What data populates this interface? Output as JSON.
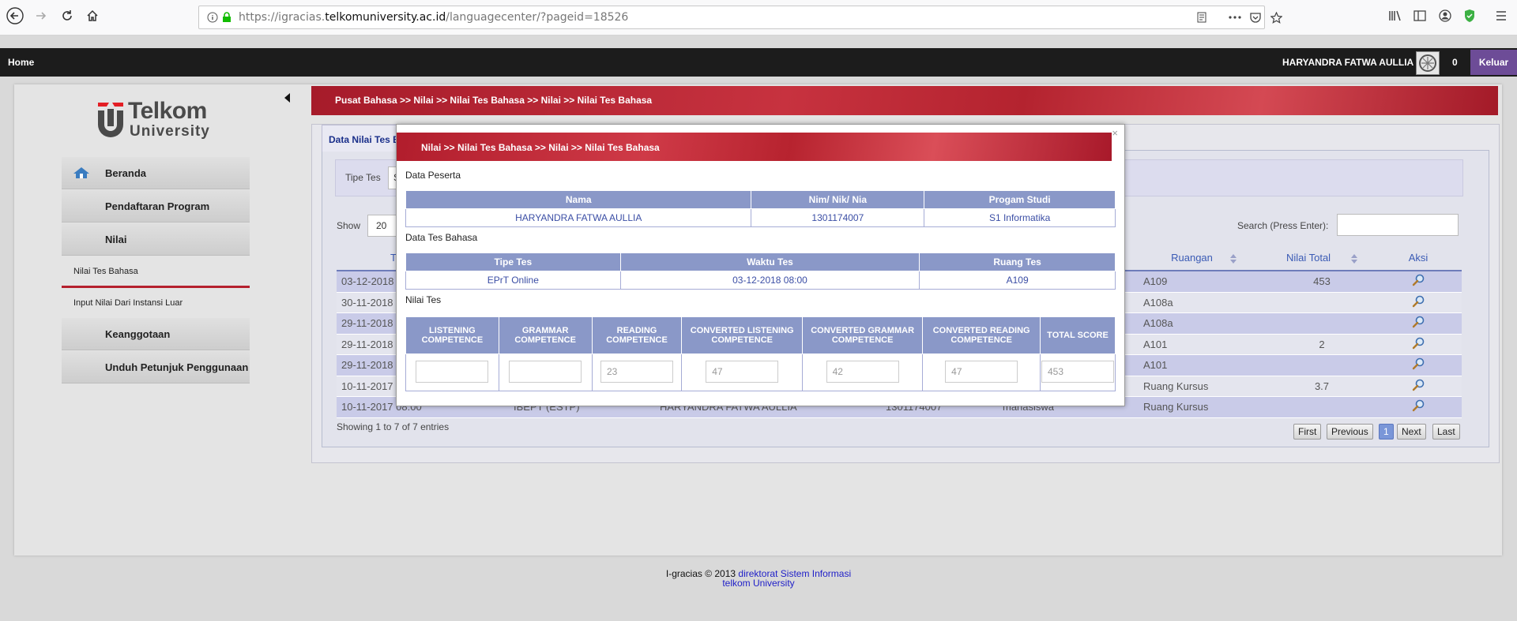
{
  "browser": {
    "url_prefix": "https://igracias.",
    "url_domain": "telkomuniversity.ac.id",
    "url_path": "/languagecenter/?pageid=18526"
  },
  "topnav": {
    "home": "Home",
    "user_name": "HARYANDRA FATWA AULLIA",
    "notif_count": "0",
    "logout": "Keluar"
  },
  "logo": {
    "word": "Telkom",
    "sub": "University"
  },
  "sidebar": {
    "items": [
      {
        "label": "Beranda"
      },
      {
        "label": "Pendaftaran Program"
      },
      {
        "label": "Nilai"
      }
    ],
    "sub_active": "Nilai Tes Bahasa",
    "sub_other": "Input Nilai Dari Instansi Luar",
    "items2": [
      {
        "label": "Keanggotaan"
      },
      {
        "label": "Unduh Petunjuk Penggunaan"
      }
    ]
  },
  "breadcrumb": "Pusat Bahasa >> Nilai >> Nilai Tes Bahasa >> Nilai >> Nilai Tes Bahasa",
  "panel": {
    "tab": "Data Nilai Tes B",
    "filter_label": "Tipe Tes",
    "filter_value": "S",
    "show_label": "Show",
    "show_value": "20",
    "search_label": "Search (Press Enter):",
    "showing": "Showing 1 to 7 of 7 entries"
  },
  "table": {
    "headers": [
      "T",
      "",
      "",
      "",
      "",
      "Ruangan",
      "Nilai Total",
      "Aksi"
    ],
    "rows": [
      {
        "c0": "03-12-2018",
        "c1": "",
        "c2": "",
        "c3": "",
        "c4": "",
        "room": "A109",
        "total": "453"
      },
      {
        "c0": "30-11-2018",
        "c1": "",
        "c2": "",
        "c3": "",
        "c4": "",
        "room": "A108a",
        "total": ""
      },
      {
        "c0": "29-11-2018",
        "c1": "",
        "c2": "",
        "c3": "",
        "c4": "",
        "room": "A108a",
        "total": ""
      },
      {
        "c0": "29-11-2018",
        "c1": "",
        "c2": "",
        "c3": "",
        "c4": "",
        "room": "A101",
        "total": "2"
      },
      {
        "c0": "29-11-2018",
        "c1": "",
        "c2": "",
        "c3": "",
        "c4": "",
        "room": "A101",
        "total": ""
      },
      {
        "c0": "10-11-2017",
        "c1": "",
        "c2": "",
        "c3": "",
        "c4": "",
        "room": "Ruang Kursus",
        "total": "3.7"
      },
      {
        "c0": "10-11-2017 08:00",
        "c1": "IBEPT (ESTP)",
        "c2": "HARYANDRA FATWA AULLIA",
        "c3": "1301174007",
        "c4": "mahasiswa",
        "room": "Ruang Kursus",
        "total": ""
      }
    ]
  },
  "pagination": {
    "first": "First",
    "previous": "Previous",
    "current": "1",
    "next": "Next",
    "last": "Last"
  },
  "modal": {
    "title": "Nilai >> Nilai Tes Bahasa >> Nilai >> Nilai Tes Bahasa",
    "close": "×",
    "peserta_title": "Data Peserta",
    "peserta_headers": [
      "Nama",
      "Nim/ Nik/ Nia",
      "Progam Studi"
    ],
    "peserta_values": [
      "HARYANDRA FATWA AULLIA",
      "1301174007",
      "S1 Informatika"
    ],
    "tes_title": "Data Tes Bahasa",
    "tes_headers": [
      "Tipe Tes",
      "Waktu Tes",
      "Ruang Tes"
    ],
    "tes_values": [
      "EPrT Online",
      "03-12-2018 08:00",
      "A109"
    ],
    "nilai_title": "Nilai Tes",
    "score_headers": [
      "LISTENING COMPETENCE",
      "GRAMMAR COMPETENCE",
      "READING COMPETENCE",
      "CONVERTED LISTENING COMPETENCE",
      "CONVERTED GRAMMAR COMPETENCE",
      "CONVERTED READING COMPETENCE",
      "TOTAL SCORE"
    ],
    "score_values": [
      "",
      "",
      "23",
      "47",
      "42",
      "47",
      "453"
    ]
  },
  "footer": {
    "text": "I-gracias © 2013 ",
    "link1": "direktorat Sistem Informasi",
    "link2": "telkom University"
  },
  "colors": {
    "brand_red": "#b5202e",
    "logout_purple": "#6d4c97",
    "table_header": "#8a98c8"
  }
}
